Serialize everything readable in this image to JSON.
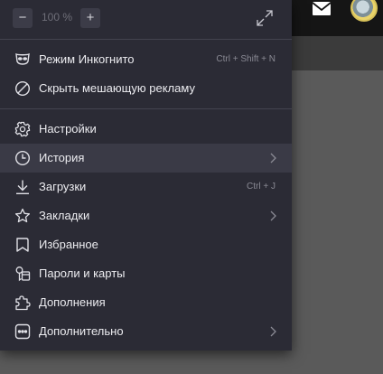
{
  "zoom": {
    "minus_label": "−",
    "plus_label": "+",
    "value": "100 %"
  },
  "menu": {
    "items": [
      {
        "label": "Режим Инкогнито",
        "shortcut": "Ctrl + Shift + N",
        "icon": "incognito-mask-icon"
      },
      {
        "label": "Скрыть мешающую рекламу",
        "shortcut": "",
        "icon": "block-ads-icon"
      },
      {
        "label": "Настройки",
        "shortcut": "",
        "icon": "gear-icon"
      },
      {
        "label": "История",
        "shortcut": "",
        "icon": "clock-icon",
        "submenu": true,
        "highlighted": true
      },
      {
        "label": "Загрузки",
        "shortcut": "Ctrl + J",
        "icon": "download-icon"
      },
      {
        "label": "Закладки",
        "shortcut": "",
        "icon": "star-icon",
        "submenu": true
      },
      {
        "label": "Избранное",
        "shortcut": "",
        "icon": "bookmark-icon"
      },
      {
        "label": "Пароли и карты",
        "shortcut": "",
        "icon": "key-card-icon"
      },
      {
        "label": "Дополнения",
        "shortcut": "",
        "icon": "puzzle-icon"
      },
      {
        "label": "Дополнительно",
        "shortcut": "",
        "icon": "more-dots-icon",
        "submenu": true
      }
    ]
  },
  "colors": {
    "menu_bg": "#2b2b35",
    "hover_bg": "#3a3a46",
    "text": "#ececf0",
    "shortcut_text": "#8a8a94"
  }
}
